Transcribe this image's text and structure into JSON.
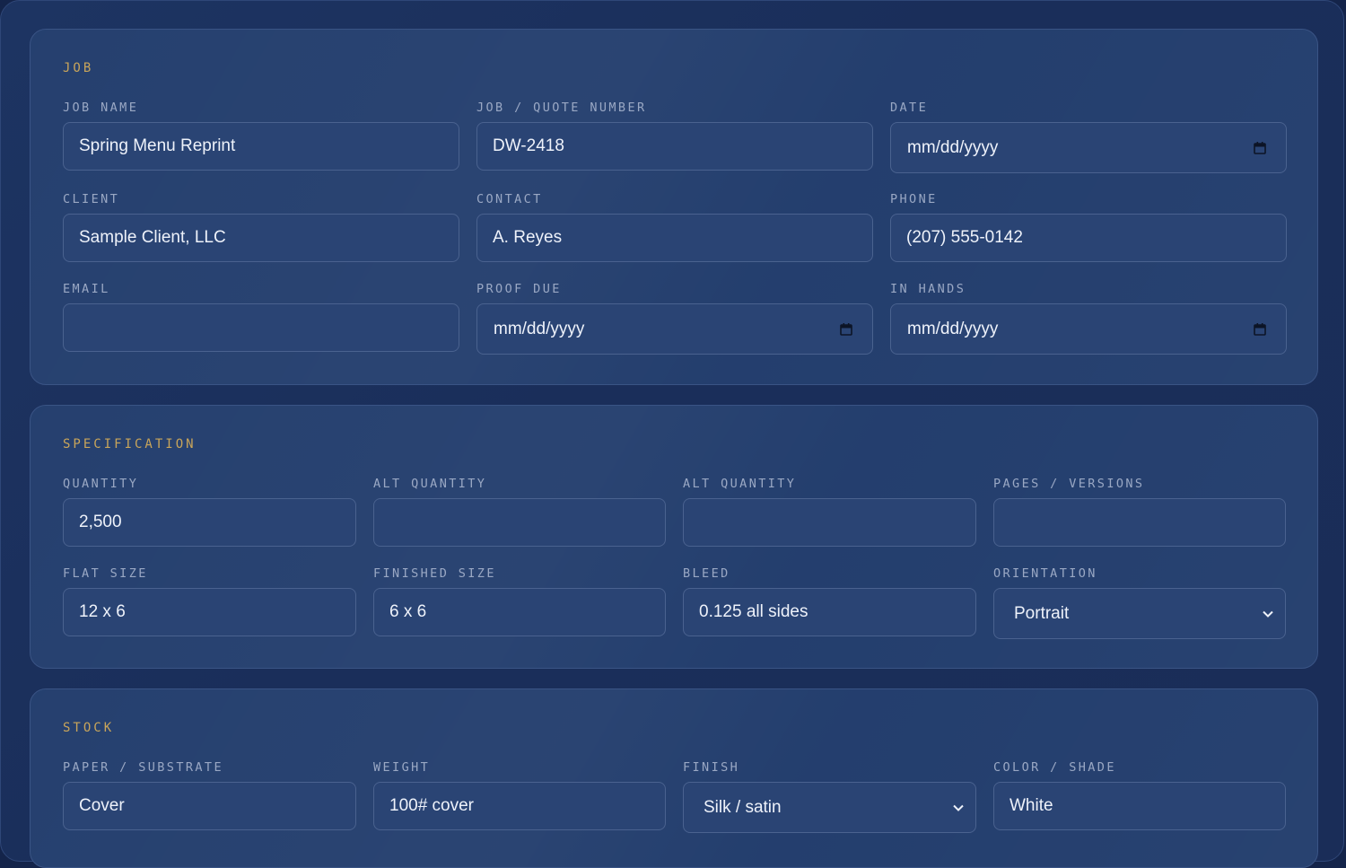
{
  "job": {
    "section_title": "JOB",
    "job_name": {
      "label": "JOB NAME",
      "value": "Spring Menu Reprint"
    },
    "quote_number": {
      "label": "JOB / QUOTE NUMBER",
      "value": "DW-2418"
    },
    "date": {
      "label": "DATE",
      "value": "mm/dd/yyyy"
    },
    "client": {
      "label": "CLIENT",
      "value": "Sample Client, LLC"
    },
    "contact": {
      "label": "CONTACT",
      "value": "A. Reyes"
    },
    "phone": {
      "label": "PHONE",
      "value": "(207) 555-0142"
    },
    "email": {
      "label": "EMAIL",
      "value": ""
    },
    "proof_due": {
      "label": "PROOF DUE",
      "value": "mm/dd/yyyy"
    },
    "in_hands": {
      "label": "IN HANDS",
      "value": "mm/dd/yyyy"
    }
  },
  "specification": {
    "section_title": "SPECIFICATION",
    "quantity": {
      "label": "QUANTITY",
      "value": "2,500"
    },
    "alt_quantity_1": {
      "label": "ALT QUANTITY",
      "value": ""
    },
    "alt_quantity_2": {
      "label": "ALT QUANTITY",
      "value": ""
    },
    "pages_versions": {
      "label": "PAGES / VERSIONS",
      "value": ""
    },
    "flat_size": {
      "label": "FLAT SIZE",
      "value": "12 x 6"
    },
    "finished_size": {
      "label": "FINISHED SIZE",
      "value": "6 x 6"
    },
    "bleed": {
      "label": "BLEED",
      "value": "0.125 all sides"
    },
    "orientation": {
      "label": "ORIENTATION",
      "value": "Portrait"
    }
  },
  "stock": {
    "section_title": "STOCK",
    "paper": {
      "label": "PAPER / SUBSTRATE",
      "value": "Cover"
    },
    "weight": {
      "label": "WEIGHT",
      "value": "100# cover"
    },
    "finish": {
      "label": "FINISH",
      "value": "Silk / satin"
    },
    "color": {
      "label": "COLOR / SHADE",
      "value": "White"
    }
  },
  "colors": {
    "accent_gold": "#c9a55a",
    "label_gray": "#9aa8c4",
    "input_bg": "#2a4474",
    "card_bg": "#213c6c",
    "page_bg": "#14244a"
  }
}
